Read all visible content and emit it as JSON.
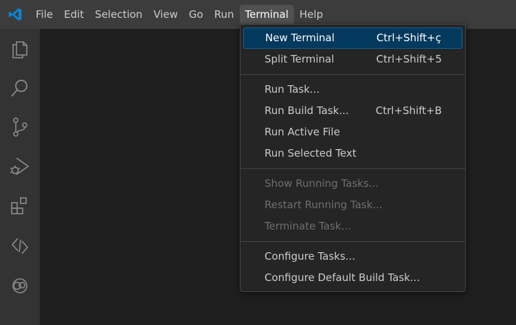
{
  "app": {
    "logo_icon": "vscode-icon",
    "accent": "#0078d4"
  },
  "menubar": {
    "items": [
      {
        "label": "File"
      },
      {
        "label": "Edit"
      },
      {
        "label": "Selection"
      },
      {
        "label": "View"
      },
      {
        "label": "Go"
      },
      {
        "label": "Run"
      },
      {
        "label": "Terminal"
      },
      {
        "label": "Help"
      }
    ],
    "active": "Terminal"
  },
  "activitybar": {
    "icons": [
      "explorer-icon",
      "search-icon",
      "source-control-icon",
      "run-debug-icon",
      "extensions-icon",
      "remote-icon",
      "copilot-icon"
    ]
  },
  "terminal_menu": {
    "groups": [
      [
        {
          "label": "New Terminal",
          "shortcut": "Ctrl+Shift+ç",
          "state": "highlighted"
        },
        {
          "label": "Split Terminal",
          "shortcut": "Ctrl+Shift+5",
          "state": "enabled"
        }
      ],
      [
        {
          "label": "Run Task...",
          "shortcut": "",
          "state": "enabled"
        },
        {
          "label": "Run Build Task...",
          "shortcut": "Ctrl+Shift+B",
          "state": "enabled"
        },
        {
          "label": "Run Active File",
          "shortcut": "",
          "state": "enabled"
        },
        {
          "label": "Run Selected Text",
          "shortcut": "",
          "state": "enabled"
        }
      ],
      [
        {
          "label": "Show Running Tasks...",
          "shortcut": "",
          "state": "disabled"
        },
        {
          "label": "Restart Running Task...",
          "shortcut": "",
          "state": "disabled"
        },
        {
          "label": "Terminate Task...",
          "shortcut": "",
          "state": "disabled"
        }
      ],
      [
        {
          "label": "Configure Tasks...",
          "shortcut": "",
          "state": "enabled"
        },
        {
          "label": "Configure Default Build Task...",
          "shortcut": "",
          "state": "enabled"
        }
      ]
    ]
  }
}
